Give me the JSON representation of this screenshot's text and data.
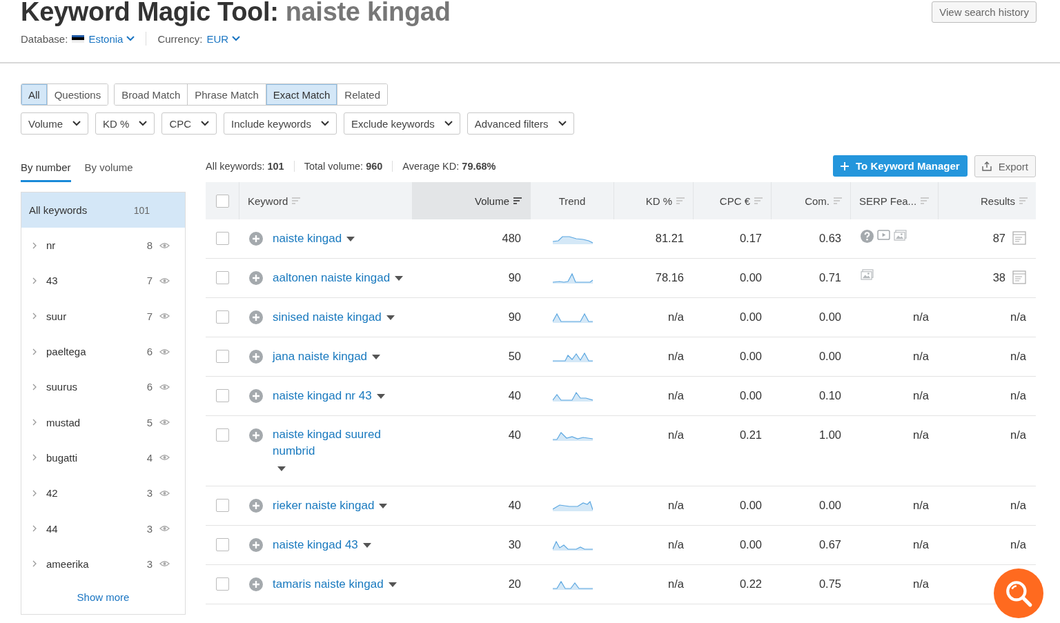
{
  "header": {
    "title": "Keyword Magic Tool:",
    "query": "naiste kingad",
    "database_label": "Database:",
    "database": "Estonia",
    "currency_label": "Currency:",
    "currency": "EUR",
    "history_button": "View search history"
  },
  "match_tabs": [
    [
      {
        "label": "All",
        "selected": true
      },
      {
        "label": "Questions",
        "selected": false
      }
    ],
    [
      {
        "label": "Broad Match",
        "selected": false
      },
      {
        "label": "Phrase Match",
        "selected": false
      },
      {
        "label": "Exact Match",
        "selected": true
      },
      {
        "label": "Related",
        "selected": false
      }
    ]
  ],
  "filters": [
    "Volume",
    "KD %",
    "CPC",
    "Include keywords",
    "Exclude keywords",
    "Advanced filters"
  ],
  "group_tabs": [
    {
      "label": "By number",
      "selected": true
    },
    {
      "label": "By volume",
      "selected": false
    }
  ],
  "stats": [
    {
      "label": "All keywords:",
      "value": "101"
    },
    {
      "label": "Total volume:",
      "value": "960"
    },
    {
      "label": "Average KD:",
      "value": "79.68%"
    }
  ],
  "actions": {
    "primary": "To Keyword Manager",
    "export": "Export"
  },
  "sidebar": {
    "all": {
      "label": "All keywords",
      "count": "101",
      "selected": true
    },
    "items": [
      {
        "name": "nr",
        "count": "8",
        "selected": false
      },
      {
        "name": "43",
        "count": "7",
        "selected": false
      },
      {
        "name": "suur",
        "count": "7",
        "selected": false
      },
      {
        "name": "paeltega",
        "count": "6",
        "selected": false
      },
      {
        "name": "suurus",
        "count": "6",
        "selected": false
      },
      {
        "name": "mustad",
        "count": "5",
        "selected": false
      },
      {
        "name": "bugatti",
        "count": "4",
        "selected": false
      },
      {
        "name": "42",
        "count": "3",
        "selected": false
      },
      {
        "name": "44",
        "count": "3",
        "selected": false
      },
      {
        "name": "ameerika",
        "count": "3",
        "selected": false
      }
    ],
    "show_more": "Show more"
  },
  "table": {
    "select_all": {
      "checked": false
    },
    "columns": [
      {
        "label": "Keyword",
        "sorted": false
      },
      {
        "label": "Volume",
        "sorted": true
      },
      {
        "label": "Trend",
        "sorted": false
      },
      {
        "label": "KD %",
        "sorted": false
      },
      {
        "label": "CPC €",
        "sorted": false
      },
      {
        "label": "Com.",
        "sorted": false
      },
      {
        "label": "SERP Fea...",
        "sorted": false
      },
      {
        "label": "Results",
        "sorted": false
      }
    ],
    "rows": [
      {
        "checked": false,
        "keyword": "naiste kingad",
        "volume": "480",
        "kd": "81.21",
        "cpc": "0.17",
        "com": "0.63",
        "serp": [
          {
            "kind": "question"
          },
          {
            "kind": "video"
          },
          {
            "kind": "image"
          }
        ],
        "results": "87"
      },
      {
        "checked": false,
        "keyword": "aaltonen naiste kingad",
        "volume": "90",
        "kd": "78.16",
        "cpc": "0.00",
        "com": "0.71",
        "serp": [
          {
            "kind": "image"
          }
        ],
        "results": "38"
      },
      {
        "checked": false,
        "keyword": "sinised naiste kingad",
        "volume": "90",
        "kd": "n/a",
        "cpc": "0.00",
        "com": "0.00",
        "serp_text": "n/a",
        "results": "n/a"
      },
      {
        "checked": false,
        "keyword": "jana naiste kingad",
        "volume": "50",
        "kd": "n/a",
        "cpc": "0.00",
        "com": "0.00",
        "serp_text": "n/a",
        "results": "n/a"
      },
      {
        "checked": false,
        "keyword": "naiste kingad nr 43",
        "volume": "40",
        "kd": "n/a",
        "cpc": "0.00",
        "com": "0.10",
        "serp_text": "n/a",
        "results": "n/a"
      },
      {
        "checked": false,
        "keyword": "naiste kingad suured numbrid",
        "volume": "40",
        "kd": "n/a",
        "cpc": "0.21",
        "com": "1.00",
        "serp_text": "n/a",
        "results": "n/a"
      },
      {
        "checked": false,
        "keyword": "rieker naiste kingad",
        "volume": "40",
        "kd": "n/a",
        "cpc": "0.00",
        "com": "0.00",
        "serp_text": "n/a",
        "results": "n/a"
      },
      {
        "checked": false,
        "keyword": "naiste kingad 43",
        "volume": "30",
        "kd": "n/a",
        "cpc": "0.00",
        "com": "0.67",
        "serp_text": "n/a",
        "results": "n/a"
      },
      {
        "checked": false,
        "keyword": "tamaris naiste kingad",
        "volume": "20",
        "kd": "n/a",
        "cpc": "0.22",
        "com": "0.75",
        "serp_text": "n/a"
      }
    ]
  }
}
